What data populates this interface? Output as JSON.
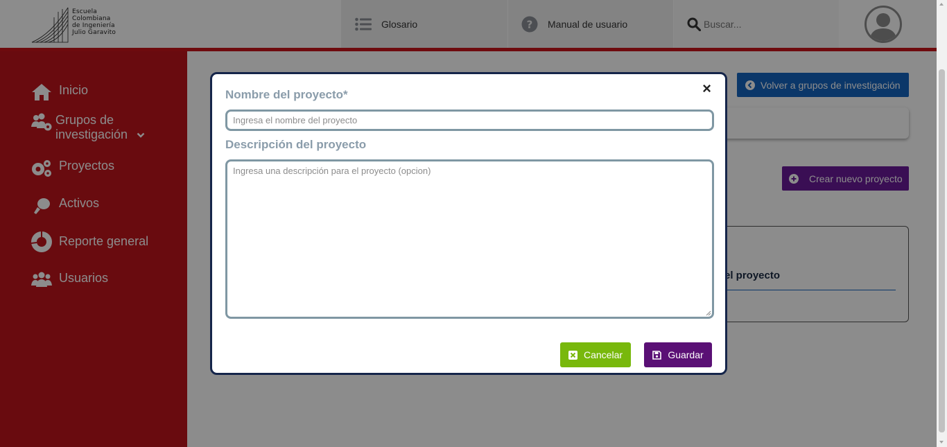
{
  "header": {
    "logo": {
      "lines": [
        "Escuela",
        "Colombiana",
        "de Ingeniería",
        "Julio Garavito"
      ]
    },
    "nav": [
      {
        "label": "Glosario",
        "icon": "list-icon"
      },
      {
        "label": "Manual de usuario",
        "icon": "help-circle-icon"
      }
    ],
    "search": {
      "placeholder": "Buscar...",
      "icon": "search-icon"
    },
    "avatar_icon": "user-avatar-icon",
    "accent_color": "#c8141a"
  },
  "sidebar": {
    "background": "#c0141c",
    "items": [
      {
        "label": "Inicio",
        "icon": "home-icon"
      },
      {
        "label": "Grupos de investigación",
        "icon": "users-gear-icon",
        "has_dropdown": true
      },
      {
        "label": "Proyectos",
        "icon": "gears-icon"
      },
      {
        "label": "Activos",
        "icon": "asset-icon"
      },
      {
        "label": "Reporte general",
        "icon": "pie-chart-icon"
      },
      {
        "label": "Usuarios",
        "icon": "users-icon"
      }
    ]
  },
  "main": {
    "back_button": "Volver a grupos de investigación",
    "create_button": "Crear nuevo proyecto",
    "list_header_fragment": "el proyecto"
  },
  "modal": {
    "close_symbol": "×",
    "name_label": "Nombre del proyecto*",
    "name_placeholder": "Ingresa el nombre del proyecto",
    "name_value": "",
    "desc_label": "Descripción del proyecto",
    "desc_placeholder": "Ingresa una descripción para el proyecto (opcion)",
    "desc_value": "",
    "cancel_label": "Cancelar",
    "save_label": "Guardar",
    "colors": {
      "cancel": "#78b80c",
      "save": "#5a1075",
      "border": "#15254a",
      "input_border": "#7f97a3"
    }
  }
}
